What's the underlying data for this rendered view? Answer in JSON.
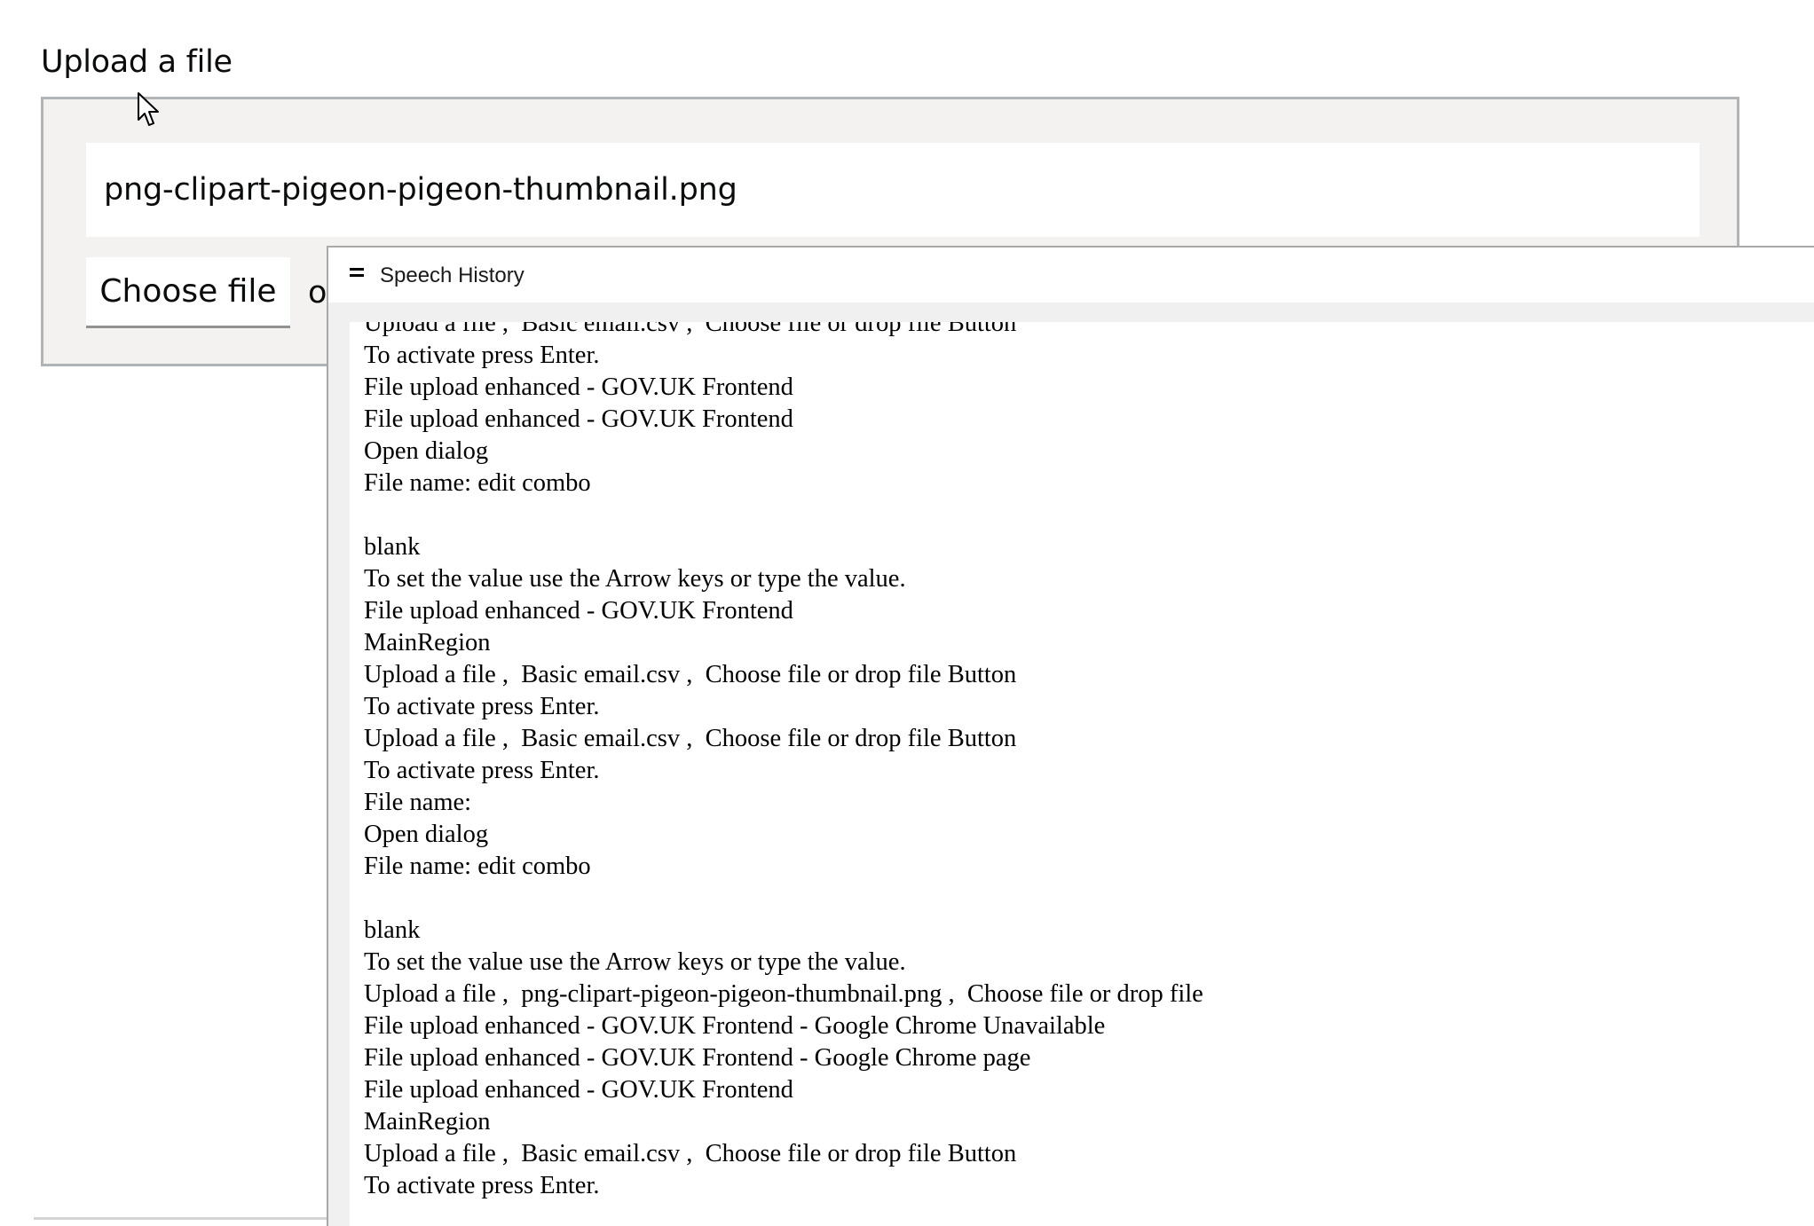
{
  "upload": {
    "label": "Upload a file",
    "selected_filename": "png-clipart-pigeon-pigeon-thumbnail.png",
    "choose_button_label": "Choose file",
    "or_text_visible": "o"
  },
  "speech_history": {
    "title": "Speech History",
    "lines": [
      "Upload a file ,  Basic email.csv ,  Choose file or drop file Button",
      "To activate press Enter.",
      "File upload enhanced - GOV.UK Frontend",
      "File upload enhanced - GOV.UK Frontend",
      "Open dialog",
      "File name: edit combo",
      "",
      "blank",
      "To set the value use the Arrow keys or type the value.",
      "File upload enhanced - GOV.UK Frontend",
      "MainRegion",
      "Upload a file ,  Basic email.csv ,  Choose file or drop file Button",
      "To activate press Enter.",
      "Upload a file ,  Basic email.csv ,  Choose file or drop file Button",
      "To activate press Enter.",
      "File name:",
      "Open dialog",
      "File name: edit combo",
      "",
      "blank",
      "To set the value use the Arrow keys or type the value.",
      "Upload a file ,  png-clipart-pigeon-pigeon-thumbnail.png ,  Choose file or drop file",
      "File upload enhanced - GOV.UK Frontend - Google Chrome Unavailable",
      "File upload enhanced - GOV.UK Frontend - Google Chrome page",
      "File upload enhanced - GOV.UK Frontend",
      "MainRegion",
      "Upload a file ,  Basic email.csv ,  Choose file or drop file Button",
      "To activate press Enter."
    ]
  },
  "icons": {
    "cursor": "mouse-pointer-icon",
    "menu": "hamburger-menu-icon"
  },
  "colors": {
    "upload_box_bg": "#f3f2f1",
    "upload_box_border": "#b1b4b6",
    "text": "#0b0c0c"
  }
}
